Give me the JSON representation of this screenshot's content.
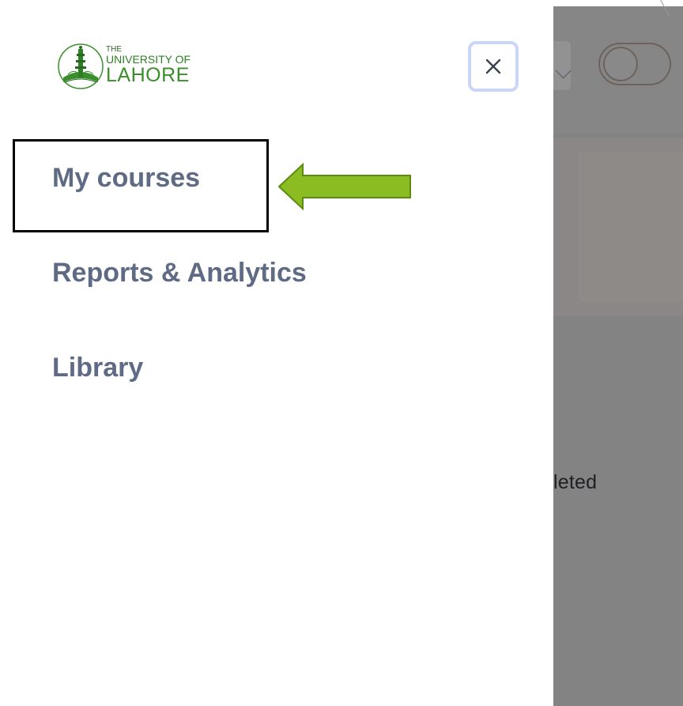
{
  "drawer": {
    "logo": {
      "line1": "THE",
      "line2": "UNIVERSITY OF",
      "line3": "LAHORE"
    },
    "close_icon": "close-icon",
    "nav_items": [
      {
        "label": "My courses",
        "highlighted": true
      },
      {
        "label": "Reports & Analytics"
      },
      {
        "label": "Library"
      }
    ]
  },
  "annotation": {
    "arrow_color": "#8bbd22",
    "box_color": "#000000"
  },
  "background_app": {
    "status_text": "leted"
  },
  "colors": {
    "nav_text": "#5f6b85",
    "close_focus_ring": "#c9d6f6",
    "logo_green": "#3a8f2c",
    "overlay": "#838383"
  }
}
